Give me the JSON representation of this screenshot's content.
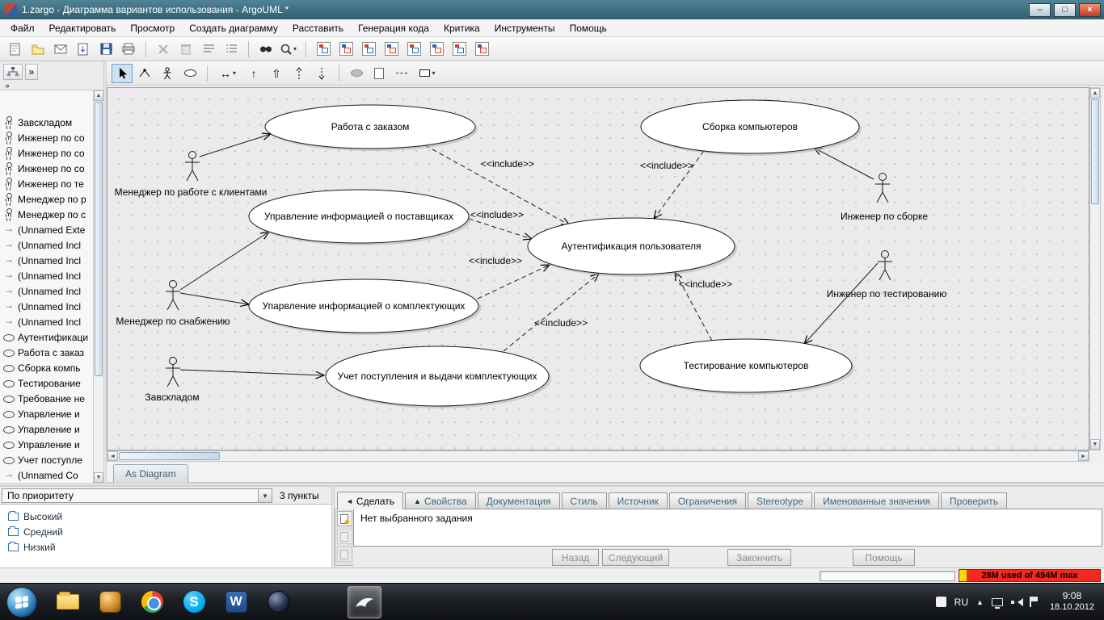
{
  "window": {
    "title": "1.zargo - Диаграмма вариантов использования - ArgoUML *",
    "buttons": {
      "minimize": "–",
      "maximize": "□",
      "close": "×"
    }
  },
  "icons": {
    "caret_down": "▾",
    "assoc": "↔",
    "arrow_up": "↑",
    "generalization": "⇧",
    "chevron": "»",
    "scroll_up": "▲",
    "scroll_down": "▼",
    "scroll_left": "◄",
    "scroll_right": "►"
  },
  "menu": {
    "items": [
      "Файл",
      "Редактировать",
      "Просмотр",
      "Создать диаграмму",
      "Расставить",
      "Генерация кода",
      "Критика",
      "Инструменты",
      "Помощь"
    ]
  },
  "explorer": {
    "items": [
      {
        "icon": "actor",
        "label": "Завскладом"
      },
      {
        "icon": "actor",
        "label": "Инженер по со"
      },
      {
        "icon": "actor",
        "label": "Инженер по со"
      },
      {
        "icon": "actor",
        "label": "Инженер по со"
      },
      {
        "icon": "actor",
        "label": "Инженер по те"
      },
      {
        "icon": "actor",
        "label": "Менеджер по р"
      },
      {
        "icon": "actor",
        "label": "Менеджер по с"
      },
      {
        "icon": "link",
        "label": "(Unnamed Exte"
      },
      {
        "icon": "link",
        "label": "(Unnamed Incl"
      },
      {
        "icon": "link",
        "label": "(Unnamed Incl"
      },
      {
        "icon": "link",
        "label": "(Unnamed Incl"
      },
      {
        "icon": "link",
        "label": "(Unnamed Incl"
      },
      {
        "icon": "link",
        "label": "(Unnamed Incl"
      },
      {
        "icon": "link",
        "label": "(Unnamed Incl"
      },
      {
        "icon": "usecase",
        "label": "Аутентификаци"
      },
      {
        "icon": "usecase",
        "label": "Работа с заказ"
      },
      {
        "icon": "usecase",
        "label": "Сборка компь"
      },
      {
        "icon": "usecase",
        "label": "Тестирование"
      },
      {
        "icon": "usecase",
        "label": "Требование не"
      },
      {
        "icon": "usecase",
        "label": "Упарвление и"
      },
      {
        "icon": "usecase",
        "label": "Упарвление и"
      },
      {
        "icon": "usecase",
        "label": "Управление и"
      },
      {
        "icon": "usecase",
        "label": "Учет поступле"
      },
      {
        "icon": "link",
        "label": "(Unnamed Co"
      }
    ]
  },
  "diagram": {
    "tab_label": "As Diagram",
    "include_label": "<<include>>",
    "use_cases": [
      {
        "label": "Работа с заказом"
      },
      {
        "label": "Сборка компьютеров"
      },
      {
        "label": "Управление информацией о поставщиках"
      },
      {
        "label": "Аутентификация пользователя"
      },
      {
        "label": "Упарвление информацией о комплектующих"
      },
      {
        "label": "Учет поступления и выдачи комплектующих"
      },
      {
        "label": "Тестирование компьютеров"
      }
    ],
    "actors": [
      {
        "label": "Менеджер по работе с клиентами"
      },
      {
        "label": "Менеджер по снабжению"
      },
      {
        "label": "Завскладом"
      },
      {
        "label": "Инженер по сборке"
      },
      {
        "label": "Инженер по тестированию"
      }
    ]
  },
  "todo": {
    "filter_label": "По приоритету",
    "count_label": "3 пункты",
    "items": [
      "Высокий",
      "Средний",
      "Низкий"
    ]
  },
  "details": {
    "tabs": [
      {
        "icon": "◄",
        "label": "Сделать"
      },
      {
        "icon": "▲",
        "label": "Свойства"
      },
      {
        "icon": "",
        "label": "Документация"
      },
      {
        "icon": "",
        "label": "Стиль"
      },
      {
        "icon": "",
        "label": "Источник"
      },
      {
        "icon": "",
        "label": "Ограничения"
      },
      {
        "icon": "",
        "label": "Stereotype"
      },
      {
        "icon": "",
        "label": "Именованные значения"
      },
      {
        "icon": "",
        "label": "Проверить"
      }
    ],
    "message": "Нет выбранного задания",
    "buttons": [
      "Назад",
      "Следующий",
      "Закончить",
      "Помощь"
    ]
  },
  "status": {
    "memory": "28M used of 494M max"
  },
  "taskbar": {
    "apps": [
      "explorer",
      "amber-app",
      "chrome",
      "skype",
      "word",
      "media-sphere",
      "argouml"
    ],
    "tray": {
      "lang": "RU",
      "time": "9:08",
      "date": "18.10.2012"
    }
  }
}
